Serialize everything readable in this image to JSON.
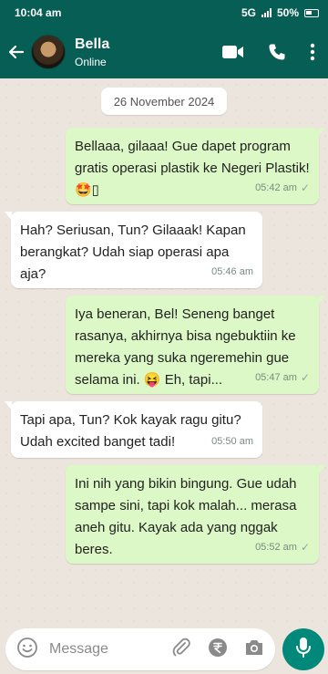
{
  "status_bar": {
    "time": "10:04 am",
    "network": "5G",
    "battery": "50%"
  },
  "header": {
    "name": "Bella",
    "status": "Online"
  },
  "date": "26 November 2024",
  "messages": [
    {
      "dir": "out",
      "text": "Bellaaa, gilaaa! Gue dapet program gratis operasi plastik ke Negeri Plastik! 🤩▯",
      "time": "05:42 am"
    },
    {
      "dir": "in",
      "text": "Hah? Seriusan, Tun? Gilaaak! Kapan berangkat? Udah siap operasi apa aja?",
      "time": "05:46 am"
    },
    {
      "dir": "out",
      "text": "Iya beneran, Bel! Seneng banget rasanya, akhirnya bisa ngebuktiin ke mereka yang suka ngeremehin gue selama ini. 😝 Eh, tapi...",
      "time": "05:47 am"
    },
    {
      "dir": "in",
      "text": "Tapi apa, Tun? Kok kayak ragu gitu? Udah excited banget tadi!",
      "time": "05:50 am"
    },
    {
      "dir": "out",
      "text": "Ini nih yang bikin bingung. Gue udah sampe sini, tapi kok malah... merasa aneh gitu. Kayak ada yang nggak beres.",
      "time": "05:52 am"
    }
  ],
  "composer": {
    "placeholder": "Message"
  },
  "colors": {
    "header": "#075e54",
    "outgoing": "#dcf8c6",
    "incoming": "#ffffff",
    "mic": "#00897b"
  },
  "icons": [
    "back-arrow-icon",
    "video-call-icon",
    "phone-icon",
    "more-options-icon",
    "emoji-icon",
    "attach-icon",
    "rupee-payment-icon",
    "camera-icon",
    "mic-icon"
  ]
}
